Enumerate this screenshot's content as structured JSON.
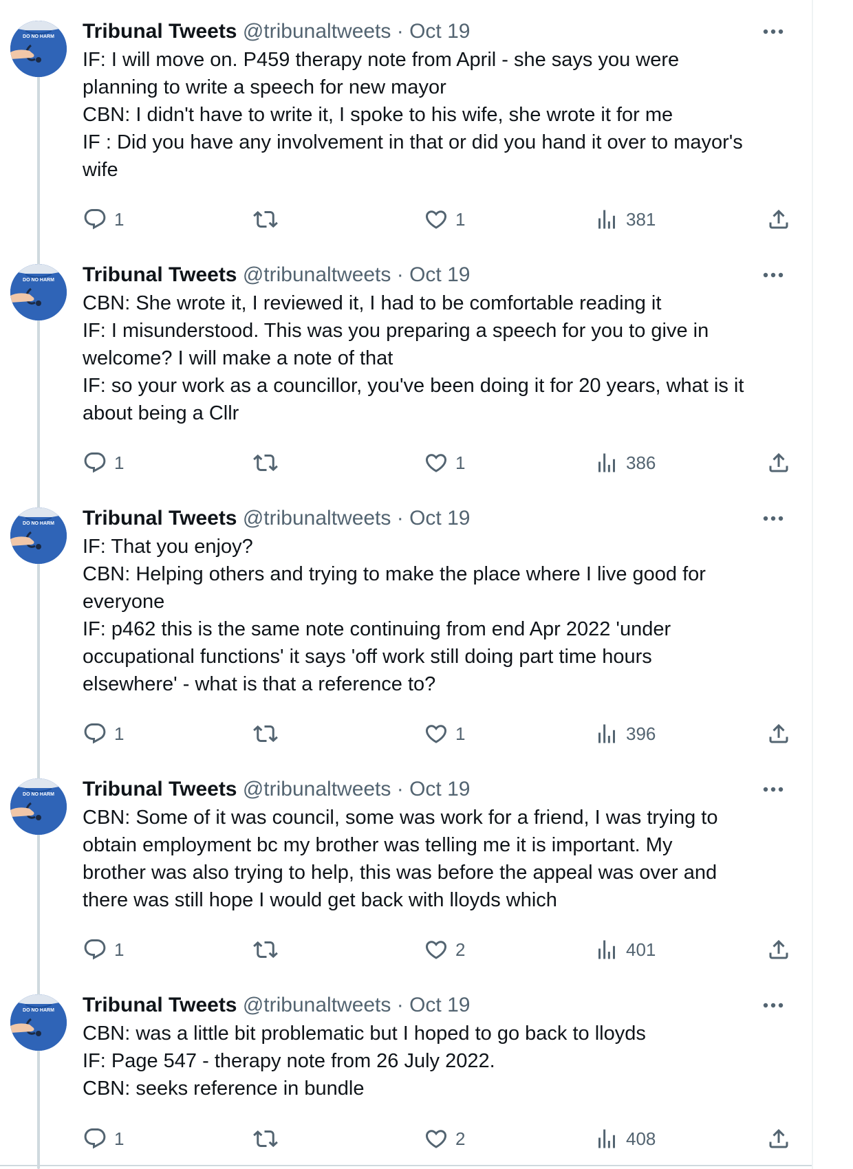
{
  "colors": {
    "text": "#0f1419",
    "secondary": "#536471",
    "thread_line": "#cfd9de",
    "avatar_shirt": "#2f64b7"
  },
  "avatar": {
    "shirt_text": "DO NO HARM"
  },
  "icons": {
    "reply": "reply-icon",
    "retweet": "retweet-icon",
    "like": "heart-icon",
    "views": "views-icon",
    "share": "share-icon",
    "more": "more-icon"
  },
  "tweets": [
    {
      "name": "Tribunal Tweets",
      "handle": "@tribunaltweets",
      "separator": "·",
      "date": "Oct 19",
      "lines": [
        "IF: I will move on. P459 therapy note from April - she says you were",
        "planning to write a speech for new mayor",
        "CBN: I didn't have to write it, I spoke to his wife, she wrote it for me",
        "IF : Did you have any involvement in that or did you hand it over to mayor's",
        "wife"
      ],
      "replies": "1",
      "likes": "1",
      "views": "381"
    },
    {
      "name": "Tribunal Tweets",
      "handle": "@tribunaltweets",
      "separator": "·",
      "date": "Oct 19",
      "lines": [
        "CBN: She wrote it, I reviewed it, I had to be comfortable reading it",
        "IF: I misunderstood.  This was you preparing a speech for you to give in",
        "welcome? I will make a note of that",
        "IF: so your work as a councillor, you've been doing it for 20 years, what is it",
        "about being a Cllr"
      ],
      "replies": "1",
      "likes": "1",
      "views": "386"
    },
    {
      "name": "Tribunal Tweets",
      "handle": "@tribunaltweets",
      "separator": "·",
      "date": "Oct 19",
      "lines": [
        "IF: That you enjoy?",
        "CBN: Helping others and trying to make the place where I live good for",
        "everyone",
        "IF: p462 this is the same note continuing from end Apr 2022 'under",
        "occupational functions' it says 'off work still doing part time hours",
        "elsewhere' - what is that a reference to?"
      ],
      "replies": "1",
      "likes": "1",
      "views": "396"
    },
    {
      "name": "Tribunal Tweets",
      "handle": "@tribunaltweets",
      "separator": "·",
      "date": "Oct 19",
      "lines": [
        "CBN: Some of it was council, some was work for a friend, I was trying to",
        "obtain employment bc my brother was telling me it is important. My",
        "brother was also trying to help, this was before the appeal was over and",
        "there was still hope I would get back with lloyds which"
      ],
      "replies": "1",
      "likes": "2",
      "views": "401"
    },
    {
      "name": "Tribunal Tweets",
      "handle": "@tribunaltweets",
      "separator": "·",
      "date": "Oct 19",
      "lines": [
        "CBN: was a  little bit problematic but I hoped to go back to lloyds",
        "IF: Page 547 - therapy note from 26 July 2022.",
        "CBN: seeks reference in bundle"
      ],
      "replies": "1",
      "likes": "2",
      "views": "408"
    }
  ]
}
